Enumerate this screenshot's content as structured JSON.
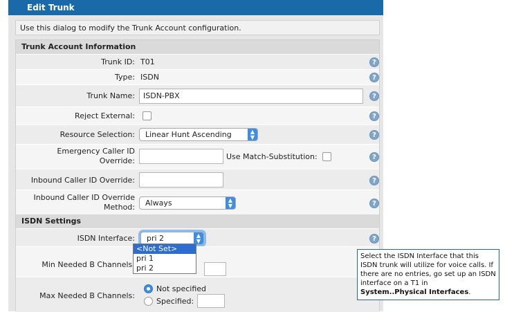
{
  "window": {
    "title": "Edit Trunk"
  },
  "intro": "Use this dialog to modify the Trunk Account configuration.",
  "sections": {
    "account": "Trunk Account Information",
    "isdn": "ISDN Settings"
  },
  "fields": {
    "trunk_id": {
      "label": "Trunk ID:",
      "value": "T01"
    },
    "type": {
      "label": "Type:",
      "value": "ISDN"
    },
    "trunk_name": {
      "label": "Trunk Name:",
      "value": "ISDN-PBX"
    },
    "reject_external": {
      "label": "Reject External:",
      "checked": false
    },
    "resource_selection": {
      "label": "Resource Selection:",
      "value": "Linear Hunt Ascending"
    },
    "emergency_caller_id": {
      "label_line1": "Emergency Caller ID",
      "label_line2": "Override:",
      "value": "",
      "match_label": "Use Match-Substitution:",
      "match_checked": false
    },
    "inbound_caller_id": {
      "label": "Inbound Caller ID Override:",
      "value": ""
    },
    "inbound_method": {
      "label_line1": "Inbound Caller ID Override",
      "label_line2": "Method:",
      "value": "Always"
    },
    "isdn_interface": {
      "label": "ISDN Interface:",
      "value": "pri 2",
      "options": [
        "<Not Set>",
        "pri 1",
        "pri 2"
      ],
      "highlighted": "<Not Set>"
    },
    "min_b_channels": {
      "label": "Min Needed B Channels:",
      "value": ""
    },
    "max_b_channels": {
      "label": "Max Needed B Channels:",
      "option_not_specified": "Not specified",
      "option_specified": "Specified:",
      "selected": "Not specified",
      "value": ""
    }
  },
  "help_icon": "question-mark-icon",
  "tooltip": {
    "text": "Select the ISDN Interface that this ISDN trunk will utilize for voice calls. If there are no entries, go set up an ISDN interface on a T1 in",
    "link": "System..Physical Interfaces",
    "end": "."
  },
  "colors": {
    "titlebar": "#1a69a8",
    "accent": "#3d8ee0",
    "highlight": "#2c6dd2"
  }
}
